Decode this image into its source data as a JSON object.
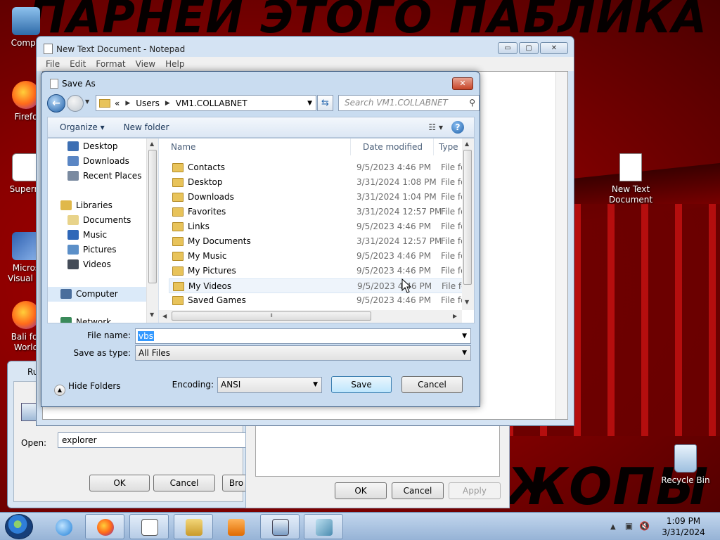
{
  "wallpaper": {
    "top_text": "ПАРНЕЙ ЭТОГО ПАБЛИКА",
    "bottom_text": "ЖОПЫ"
  },
  "desktop_icons": [
    {
      "label": "Compu",
      "icon": "computer-icon"
    },
    {
      "label": "Firefo",
      "icon": "firefox-icon"
    },
    {
      "label": "Superm",
      "icon": "app-icon"
    },
    {
      "label": "Micros Visual St",
      "icon": "visual-studio-icon"
    },
    {
      "label": "Bali for World",
      "icon": "firefox-icon"
    },
    {
      "label": "New Text Document",
      "icon": "text-file-icon"
    },
    {
      "label": "Recycle Bin",
      "icon": "recycle-bin-icon"
    }
  ],
  "run_dialog": {
    "title": "Ru",
    "open_label": "Open:",
    "open_value": "explorer",
    "ok": "OK",
    "cancel": "Cancel",
    "browse": "Bro"
  },
  "properties_dialog": {
    "ok": "OK",
    "cancel": "Cancel",
    "apply": "Apply"
  },
  "notepad": {
    "title": "New Text Document - Notepad",
    "menu": [
      "File",
      "Edit",
      "Format",
      "View",
      "Help"
    ],
    "caption_buttons": {
      "minimize": "▭",
      "maximize": "▢",
      "close": "✕"
    }
  },
  "save_as": {
    "title": "Save As",
    "close": "✕",
    "breadcrumb": {
      "overflow": "«",
      "items": [
        "Users",
        "VM1.COLLABNET"
      ]
    },
    "search_placeholder": "Search VM1.COLLABNET",
    "toolbar": {
      "organize": "Organize ▾",
      "new_folder": "New folder",
      "help": "?"
    },
    "nav_items": [
      {
        "label": "Desktop",
        "icon": "desktop-icon",
        "color": "#3d6fb3"
      },
      {
        "label": "Downloads",
        "icon": "downloads-icon",
        "color": "#5a86c4"
      },
      {
        "label": "Recent Places",
        "icon": "recent-places-icon",
        "color": "#7a8aa0"
      },
      {
        "label": "Libraries",
        "icon": "libraries-icon",
        "color": "#e0b84a"
      },
      {
        "label": "Documents",
        "icon": "documents-icon",
        "color": "#e8d38a"
      },
      {
        "label": "Music",
        "icon": "music-icon",
        "color": "#2e67b8"
      },
      {
        "label": "Pictures",
        "icon": "pictures-icon",
        "color": "#5b8fc8"
      },
      {
        "label": "Videos",
        "icon": "videos-icon",
        "color": "#444c58"
      },
      {
        "label": "Computer",
        "icon": "computer-icon",
        "color": "#4a6e9c"
      },
      {
        "label": "Network",
        "icon": "network-icon",
        "color": "#3a8a5a"
      }
    ],
    "columns": [
      "Name",
      "Date modified",
      "Type"
    ],
    "files": [
      {
        "name": "Contacts",
        "date": "9/5/2023 4:46 PM",
        "type": "File fol"
      },
      {
        "name": "Desktop",
        "date": "3/31/2024 1:08 PM",
        "type": "File fol"
      },
      {
        "name": "Downloads",
        "date": "3/31/2024 1:04 PM",
        "type": "File fol"
      },
      {
        "name": "Favorites",
        "date": "3/31/2024 12:57 PM",
        "type": "File fol"
      },
      {
        "name": "Links",
        "date": "9/5/2023 4:46 PM",
        "type": "File fol"
      },
      {
        "name": "My Documents",
        "date": "3/31/2024 12:57 PM",
        "type": "File fol"
      },
      {
        "name": "My Music",
        "date": "9/5/2023 4:46 PM",
        "type": "File fol"
      },
      {
        "name": "My Pictures",
        "date": "9/5/2023 4:46 PM",
        "type": "File fol"
      },
      {
        "name": "My Videos",
        "date": "9/5/2023 4:46 PM",
        "type": "File fol"
      },
      {
        "name": "Saved Games",
        "date": "9/5/2023 4:46 PM",
        "type": "File fol"
      }
    ],
    "file_name_label": "File name:",
    "file_name_value": "vbs",
    "save_as_type_label": "Save as type:",
    "save_as_type_value": "All Files",
    "hide_folders": "Hide Folders",
    "encoding_label": "Encoding:",
    "encoding_value": "ANSI",
    "save": "Save",
    "cancel": "Cancel"
  },
  "taskbar": {
    "apps": [
      "internet-explorer-icon",
      "firefox-icon",
      "notepad-icon",
      "explorer-icon",
      "media-player-icon",
      "run-icon",
      "properties-icon"
    ],
    "time": "1:09 PM",
    "date": "3/31/2024",
    "tray_chevron": "▲"
  }
}
